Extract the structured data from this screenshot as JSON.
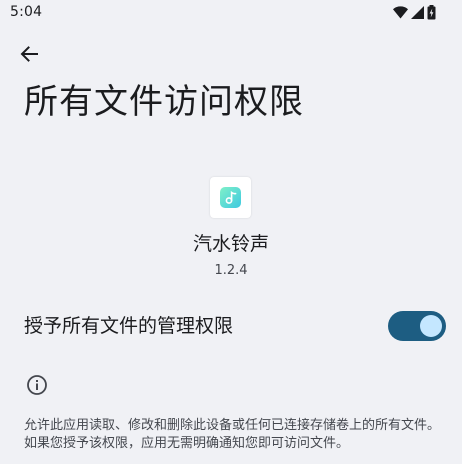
{
  "status_bar": {
    "time": "5:04",
    "icons": [
      "wifi-icon",
      "signal-icon",
      "battery-icon"
    ]
  },
  "header": {
    "back_icon": "arrow-left-icon",
    "title": "所有文件访问权限"
  },
  "app": {
    "name": "汽水铃声",
    "version": "1.2.4",
    "icon": "music-note-icon"
  },
  "permission": {
    "label": "授予所有文件的管理权限",
    "enabled": true,
    "track_color": "#1d5d82",
    "thumb_color": "#c4e7ff"
  },
  "info": {
    "icon": "info-icon",
    "description": "允许此应用读取、修改和删除此设备或任何已连接存储卷上的所有文件。如果您授予该权限，应用无需明确通知您即可访问文件。"
  },
  "colors": {
    "background": "#f0f1f5",
    "text_primary": "#1b1c1f",
    "text_secondary": "#44474e"
  }
}
